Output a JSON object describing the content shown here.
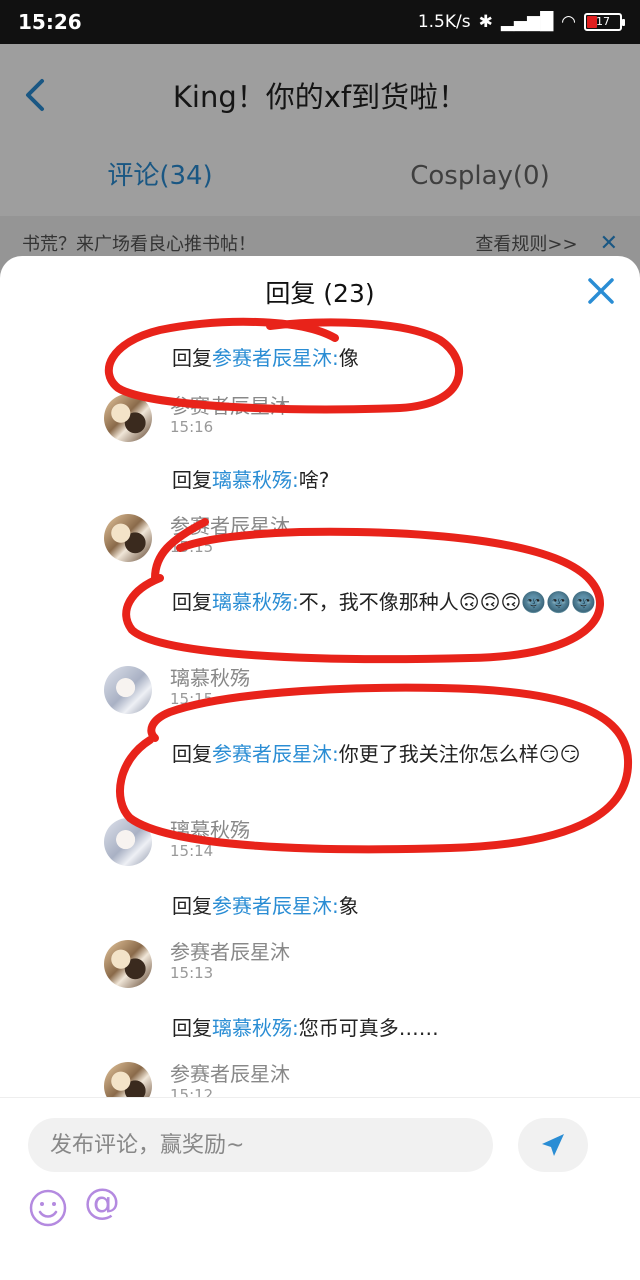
{
  "status_bar": {
    "time": "15:26",
    "speed": "1.5K/s",
    "battery": "17"
  },
  "header": {
    "title": "King！你的xf到货啦！"
  },
  "tabs": [
    {
      "label": "评论(34)"
    },
    {
      "label": "Cosplay(0)"
    }
  ],
  "notice": {
    "text": "书荒？来广场看良心推书帖！",
    "rules_link": "查看规则>>",
    "close_glyph": "✕"
  },
  "sheet": {
    "title": "回复 (23)"
  },
  "replies": [
    {
      "prefix": "回复",
      "target": "参赛者辰星沐",
      "sep": ":",
      "text": "像",
      "author": "参赛者辰星沐",
      "time": "15:16"
    },
    {
      "prefix": "回复",
      "target": "璃慕秋殇",
      "sep": ":",
      "text": "啥?",
      "author": "参赛者辰星沐",
      "time": "15:15"
    },
    {
      "prefix": "回复",
      "target": "璃慕秋殇",
      "sep": ":",
      "text": "不，我不像那种人🙃🙃🙃🌚🌚🌚",
      "author": "璃慕秋殇",
      "time": "15:15"
    },
    {
      "prefix": "回复",
      "target": "参赛者辰星沐",
      "sep": ":",
      "text": "你更了我关注你怎么样😏😏",
      "author": "璃慕秋殇",
      "time": "15:14"
    },
    {
      "prefix": "回复",
      "target": "参赛者辰星沐",
      "sep": ":",
      "text": "象",
      "author": "参赛者辰星沐",
      "time": "15:13"
    },
    {
      "prefix": "回复",
      "target": "璃慕秋殇",
      "sep": ":",
      "text": "您币可真多……",
      "author": "参赛者辰星沐",
      "time": "15:12"
    }
  ],
  "input": {
    "placeholder": "发布评论，赢奖励~",
    "at_glyph": "@"
  },
  "colors": {
    "accent": "#2a8dd4",
    "annotation": "#e8231a",
    "emoji_icon": "#b48ae0"
  }
}
